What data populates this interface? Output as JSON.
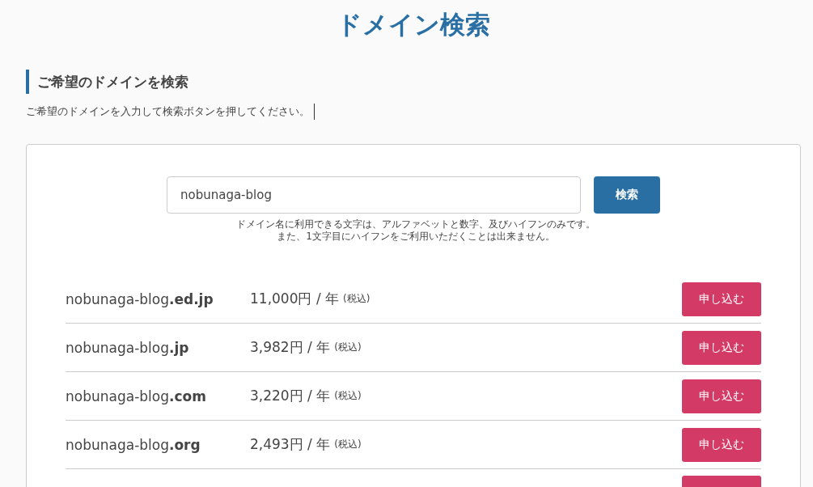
{
  "title": "ドメイン検索",
  "section": {
    "heading": "ご希望のドメインを検索",
    "description": "ご希望のドメインを入力して検索ボタンを押してください。"
  },
  "search": {
    "value": "nobunaga-blog",
    "button": "検索",
    "notes": [
      "ドメイン名に利用できる文字は、アルファベットと数字、及びハイフンのみです。",
      "また、1文字目にハイフンをご利用いただくことは出来ません。"
    ]
  },
  "results": [
    {
      "domain": "nobunaga-blog**.ed.jp**",
      "price": "11,000円 / 年",
      "tax": "(税込)",
      "button": "申し込む"
    },
    {
      "domain": "nobunaga-blog**.jp**",
      "price": "3,982円 / 年",
      "tax": "(税込)",
      "button": "申し込む"
    },
    {
      "domain": "nobunaga-blog**.com**",
      "price": "3,220円 / 年",
      "tax": "(税込)",
      "button": "申し込む"
    },
    {
      "domain": "nobunaga-blog**.org**",
      "price": "2,493円 / 年",
      "tax": "(税込)",
      "button": "申し込む"
    }
  ]
}
